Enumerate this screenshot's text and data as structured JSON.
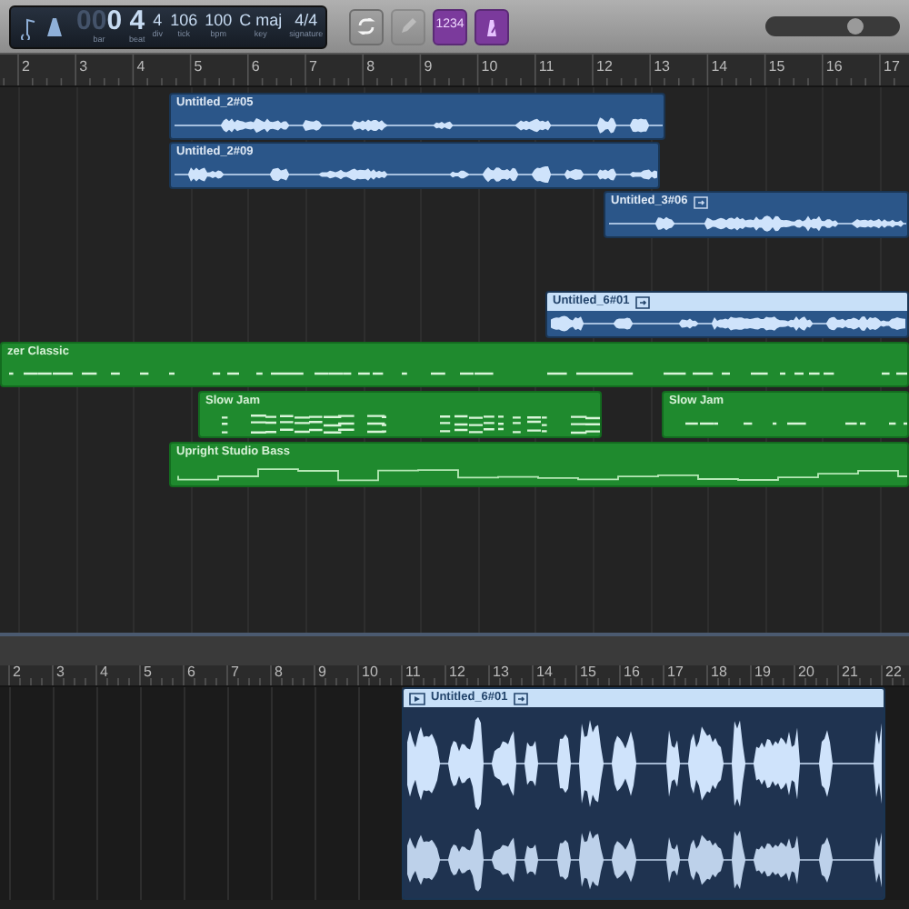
{
  "lcd": {
    "fields": [
      {
        "label": "bar",
        "lead": "00",
        "value": "0",
        "kind": "large"
      },
      {
        "label": "beat",
        "value": "4",
        "kind": "large"
      },
      {
        "label": "div",
        "value": "4",
        "kind": "small"
      },
      {
        "label": "tick",
        "value": "106",
        "kind": "small"
      },
      {
        "label": "bpm",
        "value": "100",
        "kind": "small"
      },
      {
        "label": "key",
        "value": "C maj",
        "kind": "small"
      },
      {
        "label": "signature",
        "value": "4/4",
        "kind": "small"
      }
    ]
  },
  "control_buttons": [
    {
      "kind": "cycle",
      "on": false,
      "disabled": false
    },
    {
      "kind": "pencil",
      "on": false,
      "disabled": true
    },
    {
      "kind": "count_in",
      "label": "1234",
      "on": true,
      "disabled": false
    },
    {
      "kind": "metronome",
      "on": true,
      "disabled": false
    }
  ],
  "zoom_slider": {
    "level": 0.66
  },
  "ruler": {
    "labels": [
      "2",
      "3",
      "4",
      "5",
      "6",
      "7",
      "8",
      "9",
      "10",
      "11",
      "12",
      "13",
      "14",
      "15",
      "16",
      "17"
    ]
  },
  "regions": [
    {
      "name": "Untitled_2#05",
      "kind": "audio",
      "selected": false,
      "looped": false
    },
    {
      "name": "Untitled_2#09",
      "kind": "audio",
      "selected": false,
      "looped": false
    },
    {
      "name": "Untitled_3#06",
      "kind": "audio",
      "selected": false,
      "looped": true
    },
    {
      "name": "Untitled_6#01",
      "kind": "audio",
      "selected": true,
      "looped": true
    },
    {
      "name": "zer Classic",
      "kind": "midi",
      "selected": false,
      "looped": false
    },
    {
      "name": "Slow Jam",
      "kind": "midi",
      "selected": false,
      "looped": false
    },
    {
      "name": "Slow Jam",
      "kind": "midi",
      "selected": false,
      "looped": false
    },
    {
      "name": "Upright Studio Bass",
      "kind": "midi",
      "selected": false,
      "looped": false
    }
  ],
  "editor": {
    "ruler": {
      "labels": [
        "2",
        "3",
        "4",
        "5",
        "6",
        "7",
        "8",
        "9",
        "10",
        "11",
        "12",
        "13",
        "14",
        "15",
        "16",
        "17",
        "18",
        "19",
        "20",
        "21",
        "22"
      ]
    },
    "region": {
      "name": "Untitled_6#01",
      "selected": true,
      "looped": true
    }
  }
}
